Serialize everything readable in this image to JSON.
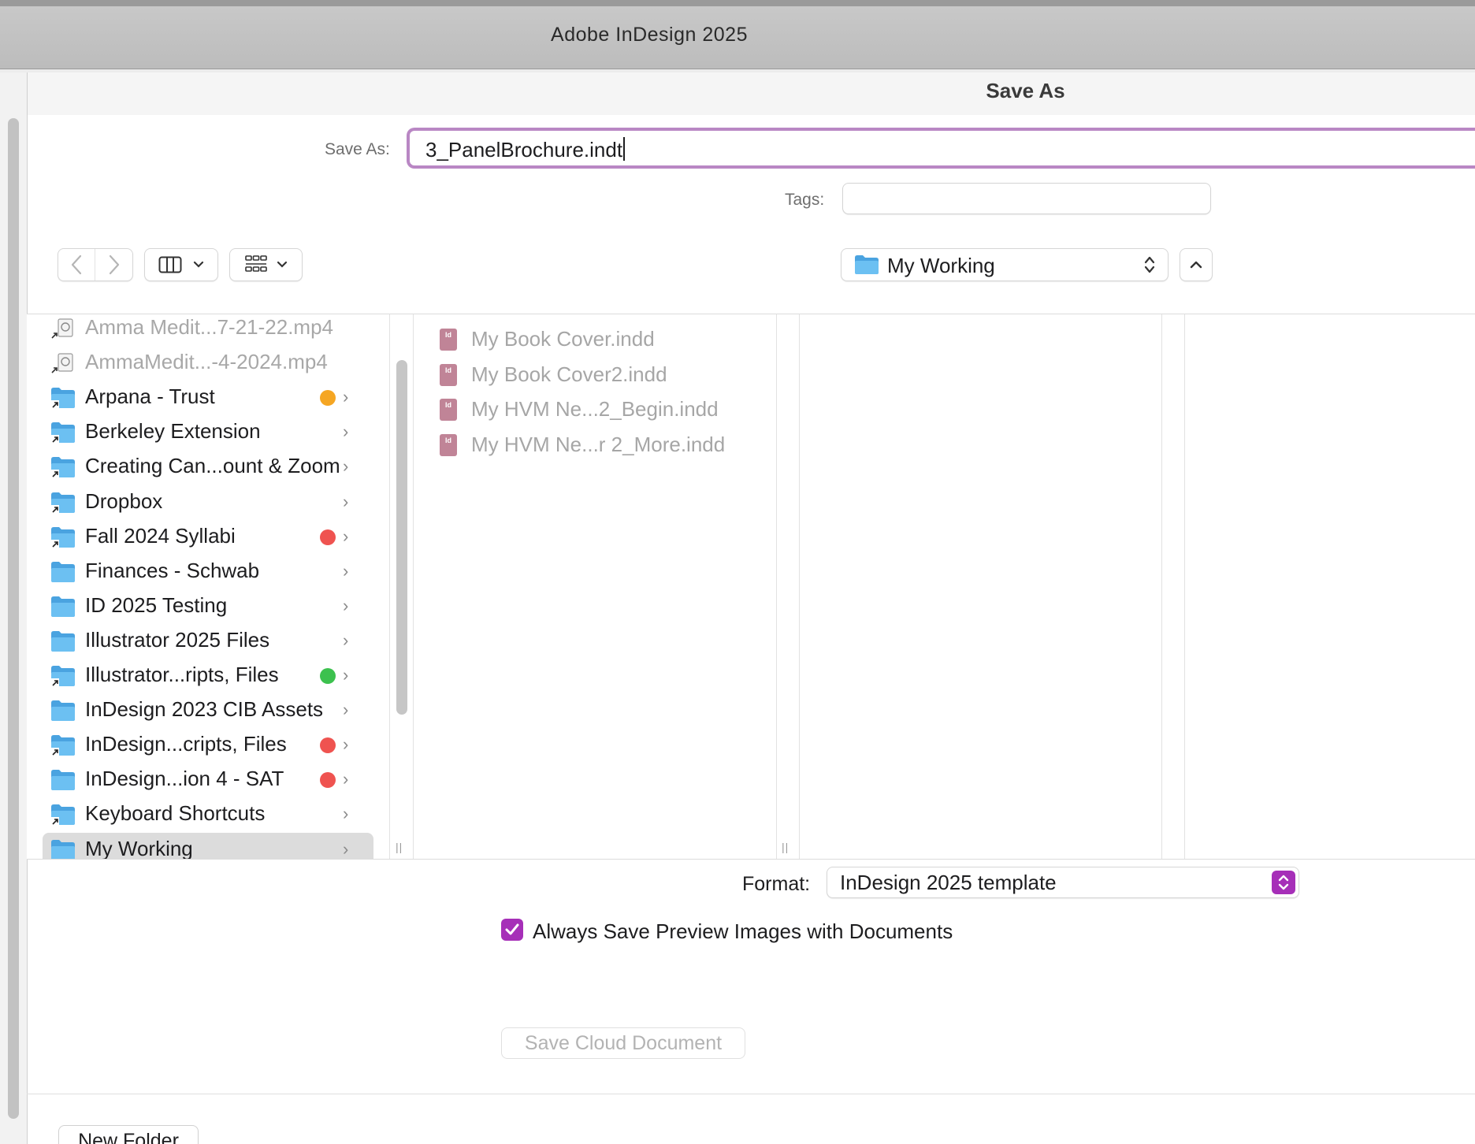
{
  "app": {
    "title": "Adobe InDesign 2025"
  },
  "dialog": {
    "title": "Save As",
    "save_as_label": "Save As:",
    "save_as_value": "3_PanelBrochure.indt",
    "tags_label": "Tags:",
    "tags_value": "",
    "location": "My Working"
  },
  "sidebar": {
    "items": [
      {
        "label": "Amma Medit...7-21-22.mp4",
        "kind": "alias-file",
        "tag": null,
        "dim": true
      },
      {
        "label": "AmmaMedit...-4-2024.mp4",
        "kind": "alias-file",
        "tag": null,
        "dim": true
      },
      {
        "label": "Arpana - Trust",
        "kind": "alias-folder",
        "tag": "#f5a623"
      },
      {
        "label": "Berkeley Extension",
        "kind": "alias-folder",
        "tag": null
      },
      {
        "label": "Creating Can...ount & Zoom",
        "kind": "alias-folder",
        "tag": null
      },
      {
        "label": "Dropbox",
        "kind": "alias-folder",
        "tag": null
      },
      {
        "label": "Fall 2024 Syllabi",
        "kind": "alias-folder",
        "tag": "#ef5350"
      },
      {
        "label": "Finances - Schwab",
        "kind": "folder",
        "tag": null
      },
      {
        "label": "ID 2025 Testing",
        "kind": "folder",
        "tag": null
      },
      {
        "label": "Illustrator 2025 Files",
        "kind": "folder",
        "tag": null
      },
      {
        "label": "Illustrator...ripts, Files",
        "kind": "alias-folder",
        "tag": "#3cc14e"
      },
      {
        "label": "InDesign 2023 CIB Assets",
        "kind": "folder",
        "tag": null
      },
      {
        "label": "InDesign...cripts, Files",
        "kind": "alias-folder",
        "tag": "#ef5350"
      },
      {
        "label": "InDesign...ion 4 - SAT",
        "kind": "folder",
        "tag": "#ef5350"
      },
      {
        "label": "Keyboard Shortcuts",
        "kind": "alias-folder",
        "tag": null
      },
      {
        "label": "My Working",
        "kind": "folder",
        "tag": null,
        "selected": true
      }
    ]
  },
  "files": [
    {
      "name": "My Book Cover.indd",
      "icon_text": "Id INDD"
    },
    {
      "name": "My Book Cover2.indd",
      "icon_text": "Id INDD"
    },
    {
      "name": "My HVM Ne...2_Begin.indd",
      "icon_text": "Id INDD"
    },
    {
      "name": "My HVM Ne...r 2_More.indd",
      "icon_text": "Id INDD"
    }
  ],
  "options": {
    "format_label": "Format:",
    "format_value": "InDesign 2025 template",
    "preview_checkbox_label": "Always Save Preview Images with Documents",
    "preview_checked": true,
    "cloud_button": "Save Cloud Document",
    "new_folder_button": "New Folder"
  },
  "colors": {
    "accent": "#a62fb8",
    "focus_ring": "#b987c4",
    "folder": "#5ab0e8",
    "indd_icon": "#c08497"
  }
}
